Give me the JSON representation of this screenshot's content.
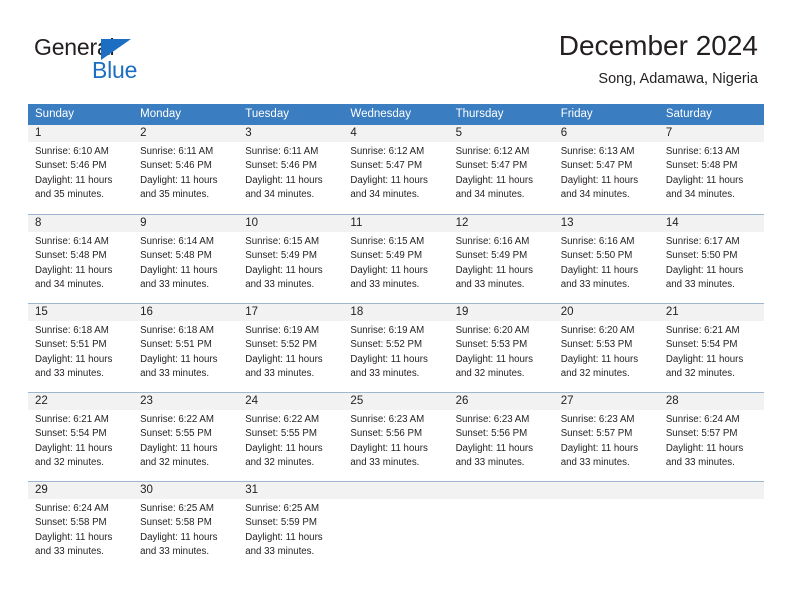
{
  "logo": {
    "text_primary": "General",
    "text_secondary": "Blue",
    "triangle_color": "#1b6ec2"
  },
  "header": {
    "title": "December 2024",
    "subtitle": "Song, Adamawa, Nigeria"
  },
  "theme": {
    "header_blue": "#3a7dc0",
    "day_number_bg": "#f2f2f2",
    "grid_line": "#9fb6cf",
    "text": "#231f20"
  },
  "weekdays": [
    "Sunday",
    "Monday",
    "Tuesday",
    "Wednesday",
    "Thursday",
    "Friday",
    "Saturday"
  ],
  "labels": {
    "sunrise_prefix": "Sunrise: ",
    "sunset_prefix": "Sunset: ",
    "daylight_prefix": "Daylight: "
  },
  "weeks": [
    [
      {
        "day": "1",
        "sunrise": "Sunrise: 6:10 AM",
        "sunset": "Sunset: 5:46 PM",
        "daylight": "Daylight: 11 hours and 35 minutes."
      },
      {
        "day": "2",
        "sunrise": "Sunrise: 6:11 AM",
        "sunset": "Sunset: 5:46 PM",
        "daylight": "Daylight: 11 hours and 35 minutes."
      },
      {
        "day": "3",
        "sunrise": "Sunrise: 6:11 AM",
        "sunset": "Sunset: 5:46 PM",
        "daylight": "Daylight: 11 hours and 34 minutes."
      },
      {
        "day": "4",
        "sunrise": "Sunrise: 6:12 AM",
        "sunset": "Sunset: 5:47 PM",
        "daylight": "Daylight: 11 hours and 34 minutes."
      },
      {
        "day": "5",
        "sunrise": "Sunrise: 6:12 AM",
        "sunset": "Sunset: 5:47 PM",
        "daylight": "Daylight: 11 hours and 34 minutes."
      },
      {
        "day": "6",
        "sunrise": "Sunrise: 6:13 AM",
        "sunset": "Sunset: 5:47 PM",
        "daylight": "Daylight: 11 hours and 34 minutes."
      },
      {
        "day": "7",
        "sunrise": "Sunrise: 6:13 AM",
        "sunset": "Sunset: 5:48 PM",
        "daylight": "Daylight: 11 hours and 34 minutes."
      }
    ],
    [
      {
        "day": "8",
        "sunrise": "Sunrise: 6:14 AM",
        "sunset": "Sunset: 5:48 PM",
        "daylight": "Daylight: 11 hours and 34 minutes."
      },
      {
        "day": "9",
        "sunrise": "Sunrise: 6:14 AM",
        "sunset": "Sunset: 5:48 PM",
        "daylight": "Daylight: 11 hours and 33 minutes."
      },
      {
        "day": "10",
        "sunrise": "Sunrise: 6:15 AM",
        "sunset": "Sunset: 5:49 PM",
        "daylight": "Daylight: 11 hours and 33 minutes."
      },
      {
        "day": "11",
        "sunrise": "Sunrise: 6:15 AM",
        "sunset": "Sunset: 5:49 PM",
        "daylight": "Daylight: 11 hours and 33 minutes."
      },
      {
        "day": "12",
        "sunrise": "Sunrise: 6:16 AM",
        "sunset": "Sunset: 5:49 PM",
        "daylight": "Daylight: 11 hours and 33 minutes."
      },
      {
        "day": "13",
        "sunrise": "Sunrise: 6:16 AM",
        "sunset": "Sunset: 5:50 PM",
        "daylight": "Daylight: 11 hours and 33 minutes."
      },
      {
        "day": "14",
        "sunrise": "Sunrise: 6:17 AM",
        "sunset": "Sunset: 5:50 PM",
        "daylight": "Daylight: 11 hours and 33 minutes."
      }
    ],
    [
      {
        "day": "15",
        "sunrise": "Sunrise: 6:18 AM",
        "sunset": "Sunset: 5:51 PM",
        "daylight": "Daylight: 11 hours and 33 minutes."
      },
      {
        "day": "16",
        "sunrise": "Sunrise: 6:18 AM",
        "sunset": "Sunset: 5:51 PM",
        "daylight": "Daylight: 11 hours and 33 minutes."
      },
      {
        "day": "17",
        "sunrise": "Sunrise: 6:19 AM",
        "sunset": "Sunset: 5:52 PM",
        "daylight": "Daylight: 11 hours and 33 minutes."
      },
      {
        "day": "18",
        "sunrise": "Sunrise: 6:19 AM",
        "sunset": "Sunset: 5:52 PM",
        "daylight": "Daylight: 11 hours and 33 minutes."
      },
      {
        "day": "19",
        "sunrise": "Sunrise: 6:20 AM",
        "sunset": "Sunset: 5:53 PM",
        "daylight": "Daylight: 11 hours and 32 minutes."
      },
      {
        "day": "20",
        "sunrise": "Sunrise: 6:20 AM",
        "sunset": "Sunset: 5:53 PM",
        "daylight": "Daylight: 11 hours and 32 minutes."
      },
      {
        "day": "21",
        "sunrise": "Sunrise: 6:21 AM",
        "sunset": "Sunset: 5:54 PM",
        "daylight": "Daylight: 11 hours and 32 minutes."
      }
    ],
    [
      {
        "day": "22",
        "sunrise": "Sunrise: 6:21 AM",
        "sunset": "Sunset: 5:54 PM",
        "daylight": "Daylight: 11 hours and 32 minutes."
      },
      {
        "day": "23",
        "sunrise": "Sunrise: 6:22 AM",
        "sunset": "Sunset: 5:55 PM",
        "daylight": "Daylight: 11 hours and 32 minutes."
      },
      {
        "day": "24",
        "sunrise": "Sunrise: 6:22 AM",
        "sunset": "Sunset: 5:55 PM",
        "daylight": "Daylight: 11 hours and 32 minutes."
      },
      {
        "day": "25",
        "sunrise": "Sunrise: 6:23 AM",
        "sunset": "Sunset: 5:56 PM",
        "daylight": "Daylight: 11 hours and 33 minutes."
      },
      {
        "day": "26",
        "sunrise": "Sunrise: 6:23 AM",
        "sunset": "Sunset: 5:56 PM",
        "daylight": "Daylight: 11 hours and 33 minutes."
      },
      {
        "day": "27",
        "sunrise": "Sunrise: 6:23 AM",
        "sunset": "Sunset: 5:57 PM",
        "daylight": "Daylight: 11 hours and 33 minutes."
      },
      {
        "day": "28",
        "sunrise": "Sunrise: 6:24 AM",
        "sunset": "Sunset: 5:57 PM",
        "daylight": "Daylight: 11 hours and 33 minutes."
      }
    ],
    [
      {
        "day": "29",
        "sunrise": "Sunrise: 6:24 AM",
        "sunset": "Sunset: 5:58 PM",
        "daylight": "Daylight: 11 hours and 33 minutes."
      },
      {
        "day": "30",
        "sunrise": "Sunrise: 6:25 AM",
        "sunset": "Sunset: 5:58 PM",
        "daylight": "Daylight: 11 hours and 33 minutes."
      },
      {
        "day": "31",
        "sunrise": "Sunrise: 6:25 AM",
        "sunset": "Sunset: 5:59 PM",
        "daylight": "Daylight: 11 hours and 33 minutes."
      },
      {
        "day": "",
        "sunrise": "",
        "sunset": "",
        "daylight": ""
      },
      {
        "day": "",
        "sunrise": "",
        "sunset": "",
        "daylight": ""
      },
      {
        "day": "",
        "sunrise": "",
        "sunset": "",
        "daylight": ""
      },
      {
        "day": "",
        "sunrise": "",
        "sunset": "",
        "daylight": ""
      }
    ]
  ]
}
